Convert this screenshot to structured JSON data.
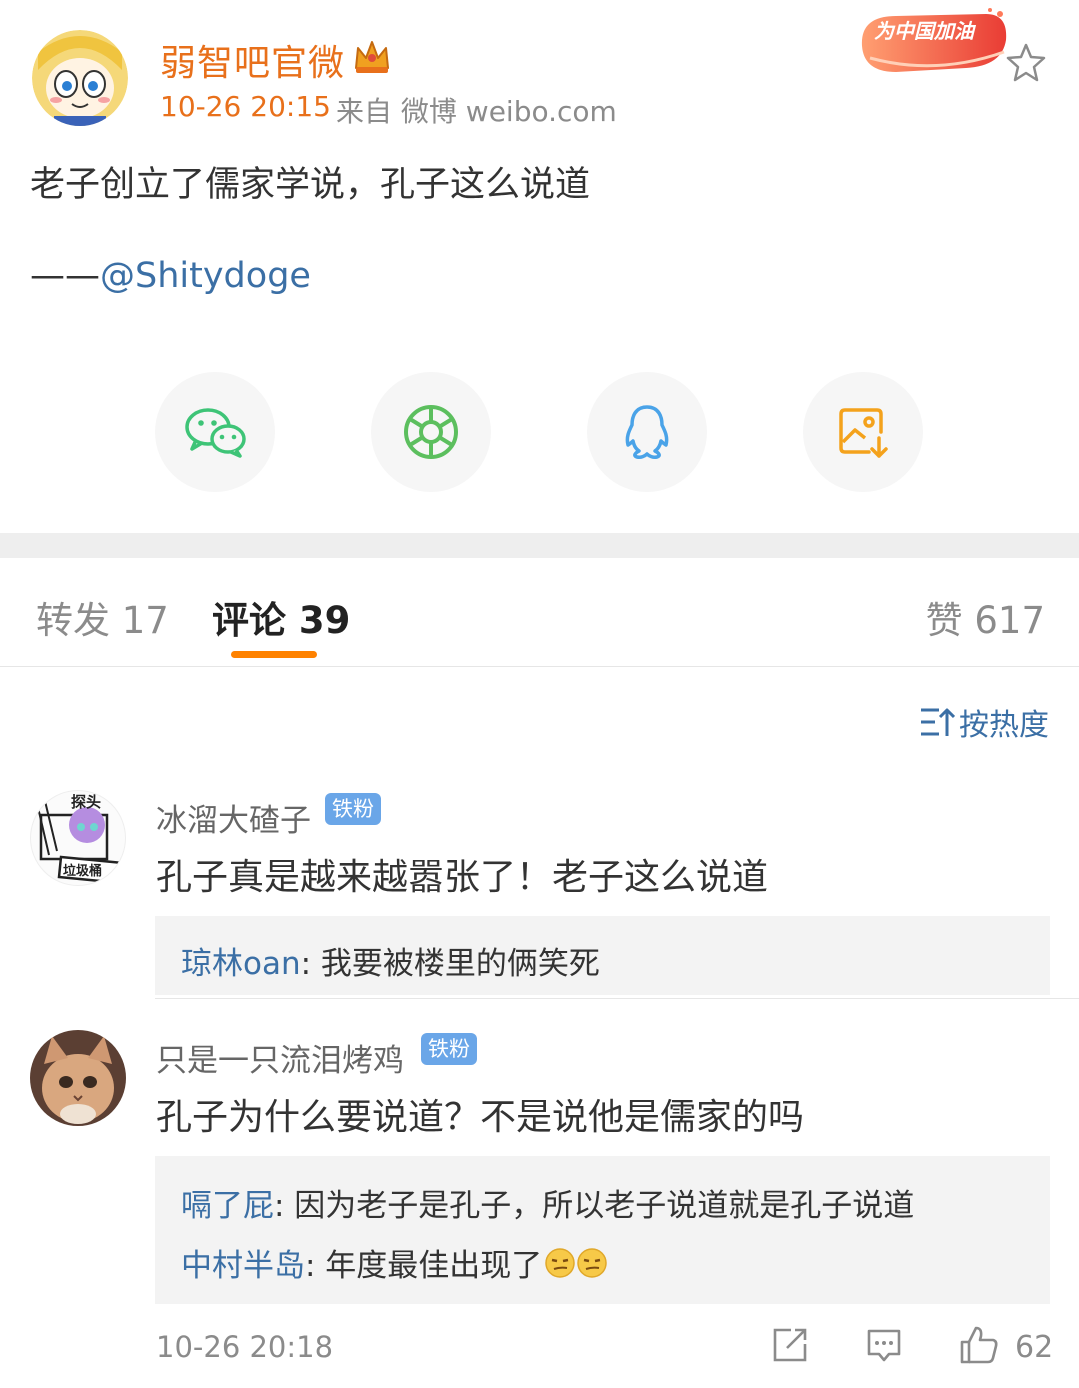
{
  "post": {
    "author": "弱智吧官微",
    "time": "10-26 20:15",
    "source": "来自 微博 weibo.com",
    "badge_text": "为中国加油",
    "text": "老子创立了儒家学说，孔子这么说道",
    "signature_dash": "——",
    "signature_mention": "@Shitydoge"
  },
  "share": {
    "icons": [
      "wechat-icon",
      "moments-icon",
      "qq-icon",
      "save-image-icon"
    ]
  },
  "tabs": {
    "repost": "转发 17",
    "comments": "评论 39",
    "likes": "赞 617"
  },
  "sort": {
    "label": "按热度"
  },
  "comments": [
    {
      "user": "冰溜大碴子",
      "badge": "铁粉",
      "avatar_text_top": "探头",
      "avatar_text_bottom": "垃圾桶",
      "text": "孔子真是越来越嚣张了！老子这么说道",
      "replies": [
        {
          "user": "琼林oan",
          "text": ": 我要被楼里的俩笑死"
        }
      ]
    },
    {
      "user": "只是一只流泪烤鸡",
      "badge": "铁粉",
      "text": "孔子为什么要说道？不是说他是儒家的吗",
      "replies": [
        {
          "user": "嗝了屁",
          "text": ": 因为老子是孔子，所以老子说道就是孔子说道"
        },
        {
          "user": "中村半岛",
          "text": ": 年度最佳出现了"
        }
      ],
      "time": "10-26 20:18",
      "likes": "62"
    }
  ],
  "colors": {
    "accent_orange": "#ff8200",
    "author_orange": "#e8701b",
    "link_blue": "#3b6fa5",
    "badge_blue": "#6aa6e8",
    "wechat_green": "#3ec477",
    "moments_green": "#5cbf5e",
    "qq_blue": "#4aa3e8",
    "save_orange": "#f4a21c"
  }
}
